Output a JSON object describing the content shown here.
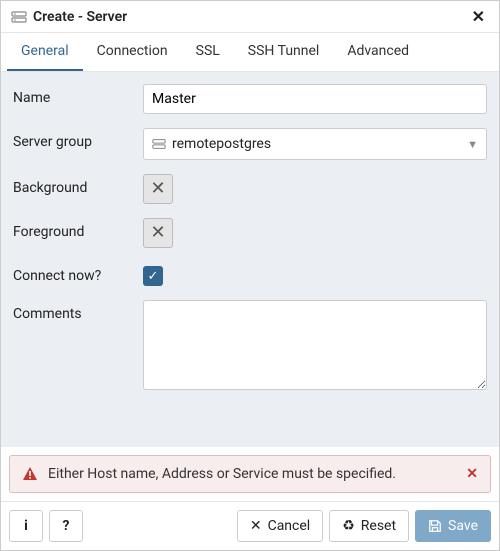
{
  "dialog": {
    "title": "Create - Server"
  },
  "tabs": {
    "general": "General",
    "connection": "Connection",
    "ssl": "SSL",
    "ssh": "SSH Tunnel",
    "advanced": "Advanced"
  },
  "form": {
    "name_label": "Name",
    "name_value": "Master",
    "group_label": "Server group",
    "group_value": "remotepostgres",
    "background_label": "Background",
    "foreground_label": "Foreground",
    "connect_label": "Connect now?",
    "comments_label": "Comments",
    "comments_value": ""
  },
  "alert": {
    "message": "Either Host name, Address or Service must be specified."
  },
  "footer": {
    "info": "i",
    "help": "?",
    "cancel": "Cancel",
    "reset": "Reset",
    "save": "Save"
  }
}
